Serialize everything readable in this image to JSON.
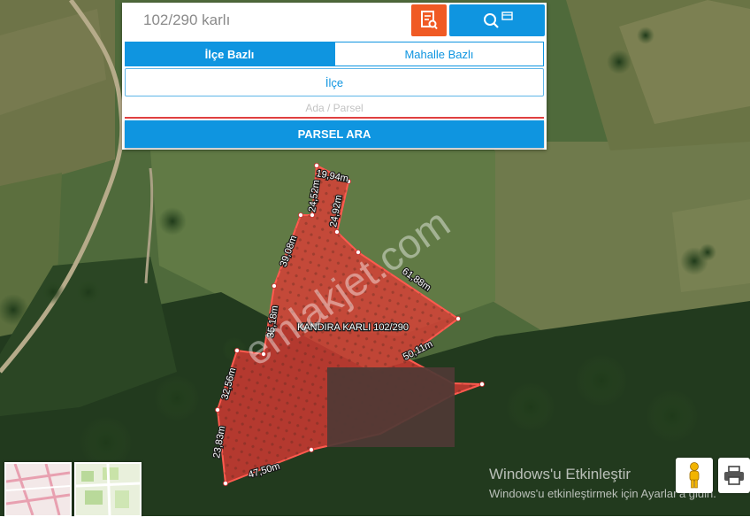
{
  "search": {
    "value": "102/290 karlı"
  },
  "tabs": [
    {
      "label": "İlçe Bazlı",
      "active": true
    },
    {
      "label": "Mahalle Bazlı",
      "active": false
    }
  ],
  "fields": {
    "ilce_label": "İlçe",
    "ada_parsel_placeholder": "Ada / Parsel"
  },
  "buttons": {
    "parsel_ara": "PARSEL ARA"
  },
  "parcel": {
    "label": "KANDIRA KARLI 102/290",
    "edges": [
      "19,94m",
      "24,92m",
      "61,88m",
      "50,11m",
      "47,50m",
      "23,83m",
      "32,56m",
      "35,18m",
      "39,08m",
      "24,52m"
    ]
  },
  "watermark": {
    "site": "emlakjet.com"
  },
  "windows_notice": {
    "title": "Windows'u Etkinleştir",
    "body": "Windows'u etkinleştirmek için Ayarlar'a gidin."
  },
  "colors": {
    "accent": "#0f95e0",
    "orange": "#f05a24",
    "parcel": "#e53935"
  },
  "icons": [
    "document-search-icon",
    "search-icon",
    "pegman-icon",
    "print-icon"
  ]
}
